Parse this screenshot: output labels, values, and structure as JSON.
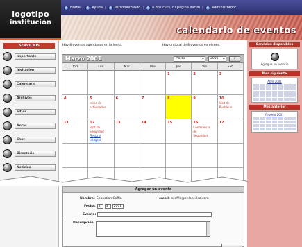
{
  "logo": {
    "line1": "logotipo",
    "line2": "institución"
  },
  "nav": [
    {
      "label": "Home",
      "icon": "globe-icon"
    },
    {
      "label": "Ayuda",
      "icon": "info-icon"
    },
    {
      "label": "Personalizando",
      "icon": "info-icon"
    },
    {
      "label": "a dos clics, tu página inicial",
      "icon": "globe-icon"
    },
    {
      "label": "Administrador",
      "icon": "globe-icon"
    }
  ],
  "page_title": "calendario de eventos",
  "sidebar": {
    "header": "SERVICIOS",
    "items": [
      {
        "label": "Importante",
        "icon": "speaker-icon"
      },
      {
        "label": "Invitación",
        "icon": "speaker-icon"
      },
      {
        "label": "Calendario",
        "icon": "calendar-icon"
      },
      {
        "label": "Archivos",
        "icon": "disc-icon"
      },
      {
        "label": "Sitios",
        "icon": "link-icon"
      },
      {
        "label": "Notas",
        "icon": "note-icon"
      },
      {
        "label": "Chat",
        "icon": "chat-icon"
      },
      {
        "label": "Directorio",
        "icon": "people-icon"
      },
      {
        "label": "Noticias",
        "icon": "news-icon"
      }
    ]
  },
  "main": {
    "note_left": "Hay 8 eventos agendados en la fecha.",
    "note_right": "Hay un total de 8 eventos en el mes."
  },
  "calendar": {
    "month_title": "Marzo 2001",
    "month_select": "Marzo",
    "year_select": "2001",
    "go_label": "ir",
    "days_of_week": [
      "Dom",
      "Lun",
      "Mar",
      "Mie",
      "Jue",
      "Vie",
      "Sab"
    ],
    "weeks": [
      [
        {
          "day": ""
        },
        {
          "day": ""
        },
        {
          "day": ""
        },
        {
          "day": ""
        },
        {
          "day": "1"
        },
        {
          "day": "2"
        },
        {
          "day": "3"
        }
      ],
      [
        {
          "day": "4"
        },
        {
          "day": "5",
          "events": [
            "Inicio de",
            "actividades"
          ]
        },
        {
          "day": "6"
        },
        {
          "day": "7"
        },
        {
          "day": "8",
          "today": true
        },
        {
          "day": "9"
        },
        {
          "day": "10",
          "events": [
            "Visit de",
            "Pueblerin"
          ]
        }
      ],
      [
        {
          "day": "11"
        },
        {
          "day": "12",
          "events": [
            "Visit de",
            "Seguridad"
          ],
          "events_link": [
            "Fiesta a",
            "Integral"
          ]
        },
        {
          "day": "13"
        },
        {
          "day": "14"
        },
        {
          "day": "15"
        },
        {
          "day": "16",
          "events": [
            "Conferencia",
            "de",
            "Seguridad"
          ]
        },
        {
          "day": "17"
        }
      ],
      [
        {
          "day": ""
        },
        {
          "day": ""
        },
        {
          "day": ""
        },
        {
          "day": ""
        },
        {
          "day": ""
        },
        {
          "day": ""
        },
        {
          "day": ""
        }
      ],
      [
        {
          "day": ""
        },
        {
          "day": ""
        },
        {
          "day": ""
        },
        {
          "day": ""
        },
        {
          "day": ""
        },
        {
          "day": ""
        },
        {
          "day": ""
        }
      ],
      [
        {
          "day": ""
        },
        {
          "day": ""
        },
        {
          "day": ""
        },
        {
          "day": ""
        },
        {
          "day": ""
        },
        {
          "day": ""
        },
        {
          "day": ""
        }
      ]
    ]
  },
  "rightbar": {
    "head1": "Servicios disponibles",
    "icon_caption": "Agregue un servicio",
    "head2": "Mes siguiente",
    "next_month": "Abril 2001",
    "head3": "Mes anterior",
    "prev_month": "Febrero 2001"
  },
  "form": {
    "title": "Agregar un evento",
    "name_label": "Nombre:",
    "name_value": "Sebastian Coffin",
    "email_label": "email:",
    "email_value": "scoffin@enlaceslaz.com",
    "date_label": "Fecha:",
    "date_day": "8",
    "date_month": "3",
    "date_year": "2001",
    "title_label": "Evento:",
    "title_value": "",
    "desc_label": "Descripción:",
    "desc_value": ""
  },
  "colors": {
    "accent_red": "#c0392b",
    "nav_blue": "#2b2f6e",
    "today_yellow": "#ffff00",
    "right_pink": "#e8a7a3"
  }
}
